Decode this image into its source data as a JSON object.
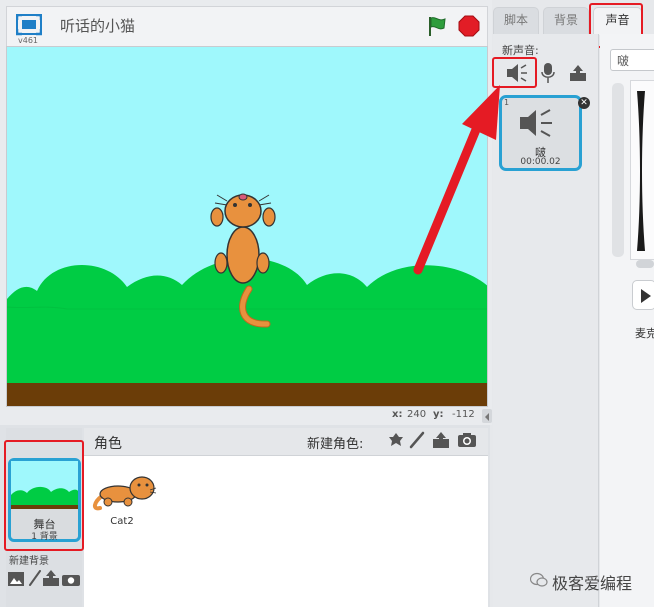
{
  "header": {
    "version": "v461",
    "project_title": "听话的小猫"
  },
  "stage": {
    "coords": {
      "x_label": "x:",
      "x_value": "240",
      "y_label": "y:",
      "y_value": "-112"
    }
  },
  "sprites": {
    "header_label": "角色",
    "new_sprite_label": "新建角色:",
    "stage_thumb": {
      "name": "舞台",
      "count": "1 背景"
    },
    "new_backdrop_label": "新建背景",
    "items": [
      {
        "name": "Cat2"
      }
    ]
  },
  "tabs": [
    {
      "label": "脚本"
    },
    {
      "label": "背景"
    },
    {
      "label": "声音"
    }
  ],
  "sounds": {
    "new_sound_label": "新声音:",
    "items": [
      {
        "index": "1",
        "name": "啵",
        "duration": "00:00.02"
      }
    ],
    "editor": {
      "name_value": "啵",
      "record_label": "麦克"
    }
  },
  "watermark": "极客爱编程",
  "colors": {
    "accent": "#29a1d3",
    "highlight": "#e51b24",
    "sky": "#9ff8fc",
    "grass": "#00cc44",
    "ground": "#6b3d08",
    "cat": "#e8913e",
    "flag": "#2e9d3c",
    "stop": "#e21d26"
  }
}
